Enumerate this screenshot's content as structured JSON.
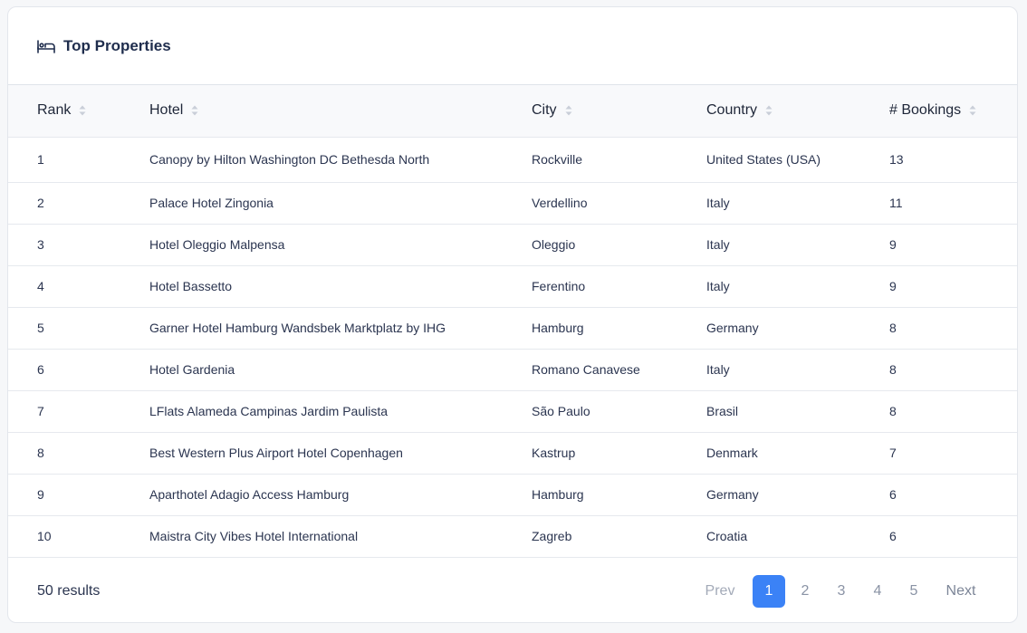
{
  "header": {
    "title": "Top Properties",
    "icon": "bed-icon"
  },
  "table": {
    "columns": [
      "Rank",
      "Hotel",
      "City",
      "Country",
      "# Bookings"
    ],
    "rows": [
      {
        "rank": "1",
        "hotel": "Canopy by Hilton Washington DC Bethesda North",
        "city": "Rockville",
        "country": "United States (USA)",
        "bookings": "13"
      },
      {
        "rank": "2",
        "hotel": "Palace Hotel Zingonia",
        "city": "Verdellino",
        "country": "Italy",
        "bookings": "11"
      },
      {
        "rank": "3",
        "hotel": "Hotel Oleggio Malpensa",
        "city": "Oleggio",
        "country": "Italy",
        "bookings": "9"
      },
      {
        "rank": "4",
        "hotel": "Hotel Bassetto",
        "city": "Ferentino",
        "country": "Italy",
        "bookings": "9"
      },
      {
        "rank": "5",
        "hotel": "Garner Hotel Hamburg Wandsbek Marktplatz by IHG",
        "city": "Hamburg",
        "country": "Germany",
        "bookings": "8"
      },
      {
        "rank": "6",
        "hotel": "Hotel Gardenia",
        "city": "Romano Canavese",
        "country": "Italy",
        "bookings": "8"
      },
      {
        "rank": "7",
        "hotel": "LFlats Alameda Campinas Jardim Paulista",
        "city": "São Paulo",
        "country": "Brasil",
        "bookings": "8"
      },
      {
        "rank": "8",
        "hotel": "Best Western Plus Airport Hotel Copenhagen",
        "city": "Kastrup",
        "country": "Denmark",
        "bookings": "7"
      },
      {
        "rank": "9",
        "hotel": "Aparthotel Adagio Access Hamburg",
        "city": "Hamburg",
        "country": "Germany",
        "bookings": "6"
      },
      {
        "rank": "10",
        "hotel": "Maistra City Vibes Hotel International",
        "city": "Zagreb",
        "country": "Croatia",
        "bookings": "6"
      }
    ]
  },
  "footer": {
    "results": "50 results",
    "prev": "Prev",
    "next": "Next",
    "pages": [
      "1",
      "2",
      "3",
      "4",
      "5"
    ],
    "active_page": "1"
  },
  "colors": {
    "accent": "#3b82f6",
    "text": "#1f2a44",
    "muted": "#8a93a5"
  }
}
